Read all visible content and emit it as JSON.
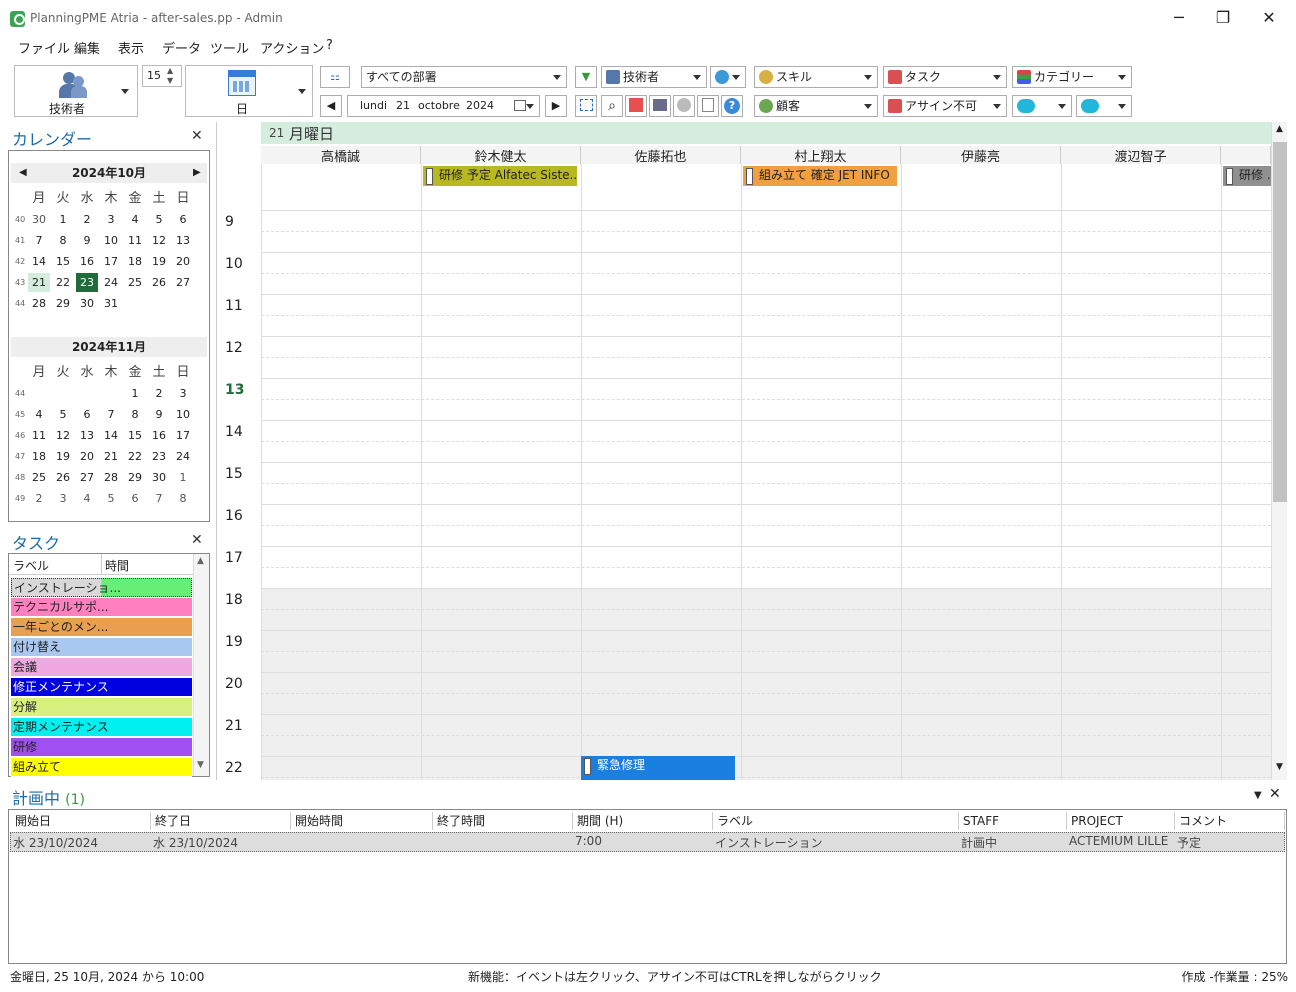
{
  "window": {
    "title": "PlanningPME Atria - after-sales.pp - Admin",
    "min": "─",
    "max": "❐",
    "close": "✕"
  },
  "menu": [
    "ファイル",
    "編集",
    "表示",
    "データ",
    "ツール",
    "アクション",
    "?"
  ],
  "toolbar": {
    "resource_label": "技術者",
    "spin_value": "15",
    "view_label": "日",
    "department": "すべての部署",
    "technician": "技術者",
    "skill": "スキル",
    "task": "タスク",
    "category": "カテゴリー",
    "client": "顧客",
    "unavailability": "アサイン不可",
    "date_day": "lundi",
    "date_num": "21",
    "date_month": "octobre",
    "date_year": "2024"
  },
  "calendar": {
    "title": "カレンダー",
    "close": "✕",
    "weekdays": [
      "月",
      "火",
      "水",
      "木",
      "金",
      "土",
      "日"
    ],
    "months": [
      {
        "label": "2024年10月",
        "weeks": [
          {
            "wk": "40",
            "days": [
              "30",
              "1",
              "2",
              "3",
              "4",
              "5",
              "6"
            ]
          },
          {
            "wk": "41",
            "days": [
              "7",
              "8",
              "9",
              "10",
              "11",
              "12",
              "13"
            ]
          },
          {
            "wk": "42",
            "days": [
              "14",
              "15",
              "16",
              "17",
              "18",
              "19",
              "20"
            ]
          },
          {
            "wk": "43",
            "days": [
              "21",
              "22",
              "23",
              "24",
              "25",
              "26",
              "27"
            ]
          },
          {
            "wk": "44",
            "days": [
              "28",
              "29",
              "30",
              "31",
              "",
              "",
              ""
            ]
          }
        ]
      },
      {
        "label": "2024年11月",
        "weeks": [
          {
            "wk": "44",
            "days": [
              "",
              "",
              "",
              "",
              "1",
              "2",
              "3"
            ]
          },
          {
            "wk": "45",
            "days": [
              "4",
              "5",
              "6",
              "7",
              "8",
              "9",
              "10"
            ]
          },
          {
            "wk": "46",
            "days": [
              "11",
              "12",
              "13",
              "14",
              "15",
              "16",
              "17"
            ]
          },
          {
            "wk": "47",
            "days": [
              "18",
              "19",
              "20",
              "21",
              "22",
              "23",
              "24"
            ]
          },
          {
            "wk": "48",
            "days": [
              "25",
              "26",
              "27",
              "28",
              "29",
              "30",
              "1"
            ]
          },
          {
            "wk": "49",
            "days": [
              "2",
              "3",
              "4",
              "5",
              "6",
              "7",
              "8"
            ]
          }
        ]
      }
    ],
    "selected": "21",
    "today": "23"
  },
  "tasks": {
    "title": "タスク",
    "close": "✕",
    "col_label": "ラベル",
    "col_time": "時間",
    "items": [
      {
        "label": "インストレーショ...",
        "color": "#d8d8d8"
      },
      {
        "label": "テクニカルサポ...",
        "color": "#ff7fbf"
      },
      {
        "label": "一年ごとのメン...",
        "color": "#e8a050"
      },
      {
        "label": "付け替え",
        "color": "#a8c8f0"
      },
      {
        "label": "会議",
        "color": "#f0a8e0"
      },
      {
        "label": "修正メンテナンス",
        "color": "#0000e0"
      },
      {
        "label": "分解",
        "color": "#d8f080"
      },
      {
        "label": "定期メンテナンス",
        "color": "#00f0f0"
      },
      {
        "label": "研修",
        "color": "#a050f0"
      },
      {
        "label": "組み立て",
        "color": "#ffff00"
      }
    ]
  },
  "planner": {
    "day_num": "21",
    "day_header": "月曜日",
    "resources": [
      "高橋誠",
      "鈴木健太",
      "佐藤拓也",
      "村上翔太",
      "伊藤亮",
      "渡辺智子"
    ],
    "hours": [
      "9",
      "10",
      "11",
      "12",
      "13",
      "14",
      "15",
      "16",
      "17",
      "18",
      "19",
      "20",
      "21",
      "22"
    ],
    "current_hour": "13",
    "events": [
      {
        "text": "研修 予定 Alfatec Siste...",
        "color": "#b8b820"
      },
      {
        "text": "組み立て 確定 JET INFO",
        "color": "#f0a040"
      },
      {
        "text": "研修 ...",
        "color": "#909090"
      },
      {
        "text": "緊急修理",
        "color": "#1a7fe0"
      }
    ]
  },
  "list": {
    "title": "計画中",
    "count": "(1)",
    "columns": [
      "開始日",
      "終了日",
      "開始時間",
      "終了時間",
      "期間 (H)",
      "ラベル",
      "STAFF",
      "PROJECT",
      "コメント"
    ],
    "rows": [
      [
        "水 23/10/2024",
        "水 23/10/2024",
        "",
        "",
        "7:00",
        "インストレーション",
        "計画中",
        "ACTEMIUM LILLE ...",
        "予定"
      ]
    ]
  },
  "status": {
    "left": "金曜日, 25 10月, 2024 から 10:00",
    "center": "新機能：イベントは左クリック、アサイン不可はCTRLを押しながらクリック",
    "right": "作成 -作業量 : 25%"
  }
}
